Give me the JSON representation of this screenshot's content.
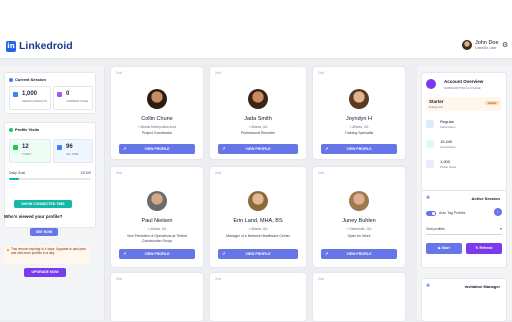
{
  "app": {
    "name": "Linkedroid",
    "logo_glyph": "in"
  },
  "user": {
    "name": "John Doe",
    "subtitle": "LinkedIn User"
  },
  "left": {
    "current_session": {
      "title": "Current Session",
      "stats": [
        {
          "value": "1,000",
          "label": "Search Results",
          "color": "#3b82f6"
        },
        {
          "value": "0",
          "label": "Current Page",
          "color": "#a855f7"
        }
      ]
    },
    "profile_visits": {
      "title": "Profile Visits",
      "stats": [
        {
          "value": "12",
          "label": "Today",
          "color": "#22c55e"
        },
        {
          "value": "96",
          "label": "All Time",
          "color": "#3b82f6"
        }
      ],
      "daily_goal_label": "Daily Goal",
      "daily_goal_value": "12/100",
      "progress": 0.12
    },
    "show_connected_btn": "SHOW CONNECTED TIME",
    "whos_viewed_title": "Who's viewed your profile?",
    "see_now_btn": "SEE NOW",
    "trial_notice": "Trial version expiring in X days. Upgrade to paid plan and visit more profiles in a day.",
    "upgrade_btn": "UPGRADE NOW"
  },
  "profiles": [
    {
      "degree": "2nd",
      "name": "Collin Chune",
      "location": "Atlanta Metropolitan Area",
      "headline": "Project Coordinator",
      "btn": "VIEW PROFILE"
    },
    {
      "degree": "2nd",
      "name": "Jada Smith",
      "location": "Atlanta, GA",
      "headline": "Professional Recruiter",
      "btn": "VIEW PROFILE"
    },
    {
      "degree": "2nd",
      "name": "Joyndyn H",
      "location": "Atlanta, GA",
      "headline": "Training Specialist",
      "btn": "VIEW PROFILE"
    },
    {
      "degree": "2nd",
      "name": "Paul Nielsen",
      "location": "Atlanta, GA",
      "headline": "Vice President of Operations at Trident Construction Group",
      "btn": "VIEW PROFILE"
    },
    {
      "degree": "2nd",
      "name": "Erin Land, MHA, BS",
      "location": "Atlanta, GA",
      "headline": "Manager of a Network Healthcare Center",
      "btn": "VIEW PROFILE"
    },
    {
      "degree": "2nd",
      "name": "Juney Buhlen",
      "location": "Gainesville, GA",
      "headline": "Open for Work",
      "btn": "VIEW PROFILE"
    },
    {
      "degree": "2nd"
    },
    {
      "degree": "2nd"
    },
    {
      "degree": "2nd"
    }
  ],
  "right": {
    "account_overview": {
      "title": "Account Overview",
      "subtitle": "SUBSCRIPTION & USAGE",
      "plan": "Starter",
      "plan_sub": "8 days left",
      "plan_badge": "Active",
      "items": [
        {
          "value": "Regular",
          "label": "Subscription"
        },
        {
          "value": "15,440",
          "label": "Connections"
        },
        {
          "value": "1,900",
          "label": "Profile Views"
        }
      ]
    },
    "active_session": {
      "title": "Active Session",
      "auto_tag_label": "Auto Tag Profiles",
      "select_value": "Visit profiles",
      "start_btn": "Start",
      "refresh_btn": "Refresh"
    },
    "invitation_manager": {
      "title": "Invitation Manager"
    }
  },
  "colors": {
    "primary": "#6676e8",
    "brand": "#1e3a8a",
    "teal": "#14b8a6",
    "purple": "#7c3aed"
  }
}
